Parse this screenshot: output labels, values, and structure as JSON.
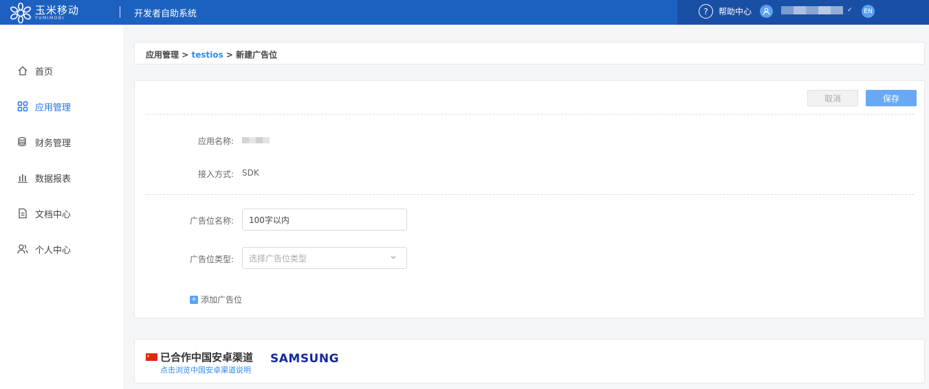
{
  "header": {
    "logo_cn": "玉米移动",
    "logo_en": "YUMIMOBI",
    "system_title": "开发者自助系统",
    "help_label": "帮助中心",
    "lang_label": "EN"
  },
  "sidebar": {
    "items": [
      {
        "label": "首页",
        "icon": "home-icon",
        "active": false
      },
      {
        "label": "应用管理",
        "icon": "grid-icon",
        "active": true
      },
      {
        "label": "财务管理",
        "icon": "coins-icon",
        "active": false
      },
      {
        "label": "数据报表",
        "icon": "bar-chart-icon",
        "active": false
      },
      {
        "label": "文档中心",
        "icon": "document-icon",
        "active": false
      },
      {
        "label": "个人中心",
        "icon": "users-icon",
        "active": false
      }
    ]
  },
  "breadcrumb": {
    "root": "应用管理",
    "sep1": ">",
    "app": "testios",
    "sep2": ">",
    "current": "新建广告位"
  },
  "form": {
    "cancel_label": "取消",
    "save_label": "保存",
    "app_name_label": "应用名称:",
    "access_label": "接入方式:",
    "access_value": "SDK",
    "slot_name_label": "广告位名称:",
    "slot_name_value": "100字以内",
    "slot_type_label": "广告位类型:",
    "slot_type_placeholder": "选择广告位类型",
    "add_slot_label": "添加广告位"
  },
  "channel": {
    "title": "已合作中国安卓渠道",
    "link": "点击浏览中国安卓渠道说明",
    "partner": "SAMSUNG"
  },
  "colors": {
    "header_bg": "#1d61c0",
    "accent": "#2d8cf0",
    "save_button": "#69a9f4"
  }
}
